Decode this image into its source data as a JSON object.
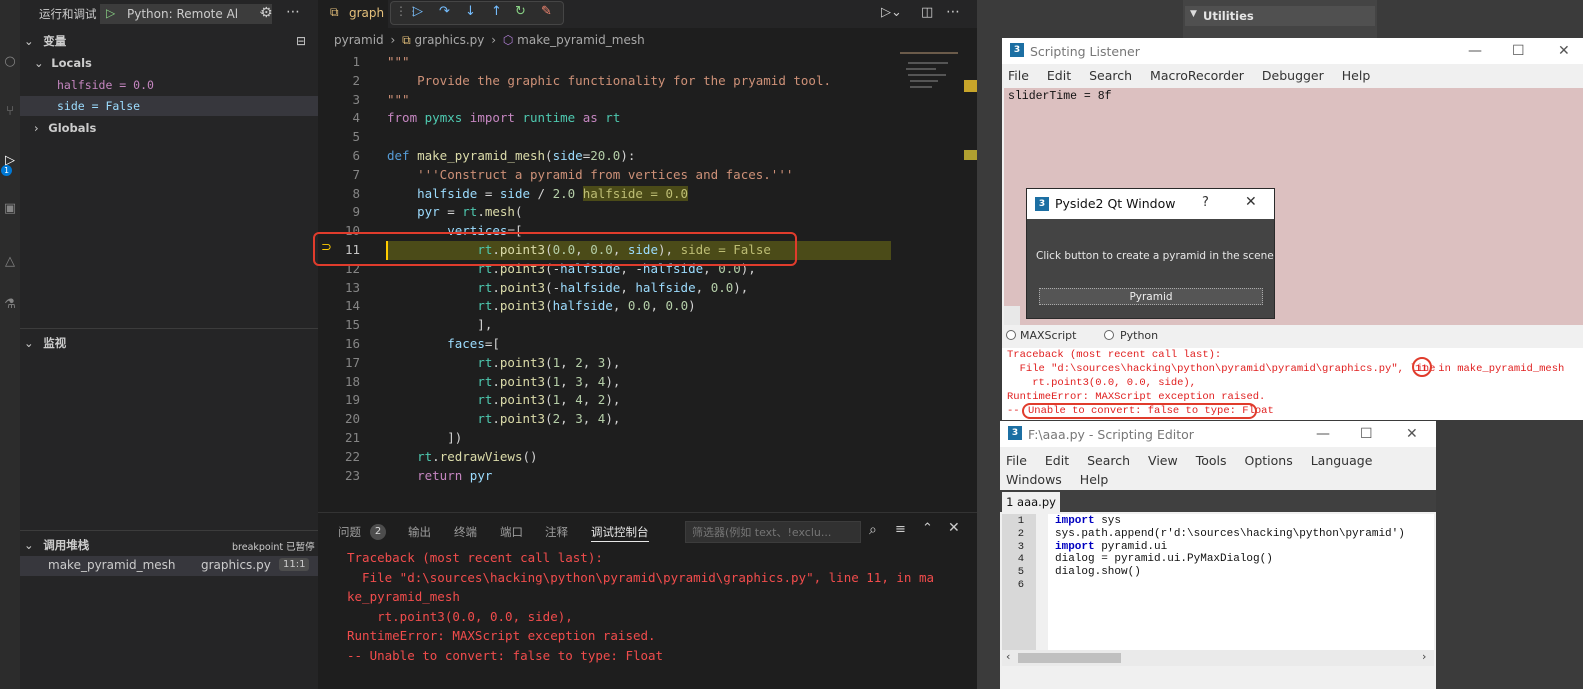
{
  "vscode": {
    "run_debug_title": "运行和调试",
    "launch_config": "Python: Remote Al",
    "editor_tab": "graph",
    "breadcrumb": [
      "pyramid",
      "graphics.py",
      "make_pyramid_mesh"
    ],
    "variables": {
      "header": "变量",
      "locals_label": "Locals",
      "locals": [
        "halfside = 0.0",
        "side = False"
      ],
      "globals_label": "Globals"
    },
    "watch_header": "监视",
    "callstack": {
      "header": "调用堆栈",
      "status": "breakpoint 已暂停",
      "frame_name": "make_pyramid_mesh",
      "frame_file": "graphics.py",
      "frame_pos": "11:1"
    },
    "activity_badge": "1",
    "code_lines": [
      {
        "n": "1",
        "segments": [
          {
            "t": "\"\"\"",
            "c": "str"
          }
        ]
      },
      {
        "n": "2",
        "segments": [
          {
            "t": "    Provide the graphic functionality for the pryamid tool.",
            "c": "str"
          }
        ]
      },
      {
        "n": "3",
        "segments": [
          {
            "t": "\"\"\"",
            "c": "str"
          }
        ]
      },
      {
        "n": "4",
        "segments": [
          {
            "t": "from ",
            "c": "kw"
          },
          {
            "t": "pymxs",
            "c": "cl"
          },
          {
            "t": " import ",
            "c": "kw"
          },
          {
            "t": "runtime",
            "c": "cl"
          },
          {
            "t": " as ",
            "c": "kw"
          },
          {
            "t": "rt",
            "c": "cl"
          }
        ]
      },
      {
        "n": "5",
        "segments": []
      },
      {
        "n": "6",
        "segments": [
          {
            "t": "def ",
            "c": "kb"
          },
          {
            "t": "make_pyramid_mesh",
            "c": "fn"
          },
          {
            "t": "(",
            "c": ""
          },
          {
            "t": "side",
            "c": "var"
          },
          {
            "t": "=",
            "c": ""
          },
          {
            "t": "20.0",
            "c": "num"
          },
          {
            "t": "):",
            "c": ""
          }
        ]
      },
      {
        "n": "7",
        "segments": [
          {
            "t": "    '''Construct a pyramid from vertices and faces.'''",
            "c": "str"
          }
        ]
      },
      {
        "n": "8",
        "segments": [
          {
            "t": "    ",
            "c": ""
          },
          {
            "t": "halfside",
            "c": "var"
          },
          {
            "t": " = ",
            "c": ""
          },
          {
            "t": "side",
            "c": "var"
          },
          {
            "t": " / ",
            "c": ""
          },
          {
            "t": "2.0",
            "c": "num"
          },
          {
            "t": " ",
            "c": ""
          },
          {
            "t": "halfside = 0.0",
            "c": "inl"
          }
        ]
      },
      {
        "n": "9",
        "segments": [
          {
            "t": "    ",
            "c": ""
          },
          {
            "t": "pyr",
            "c": "var"
          },
          {
            "t": " = ",
            "c": ""
          },
          {
            "t": "rt",
            "c": "cl"
          },
          {
            "t": ".",
            "c": ""
          },
          {
            "t": "mesh",
            "c": "fn"
          },
          {
            "t": "(",
            "c": ""
          }
        ]
      },
      {
        "n": "10",
        "segments": [
          {
            "t": "        ",
            "c": ""
          },
          {
            "t": "vertices",
            "c": "var"
          },
          {
            "t": "=[",
            "c": ""
          }
        ]
      },
      {
        "n": "11",
        "segments": [
          {
            "t": "            ",
            "c": ""
          },
          {
            "t": "rt",
            "c": "cl"
          },
          {
            "t": ".",
            "c": ""
          },
          {
            "t": "point3",
            "c": "fn"
          },
          {
            "t": "(",
            "c": ""
          },
          {
            "t": "0.0",
            "c": "num"
          },
          {
            "t": ", ",
            "c": ""
          },
          {
            "t": "0.0",
            "c": "num"
          },
          {
            "t": ", ",
            "c": ""
          },
          {
            "t": "side",
            "c": "var"
          },
          {
            "t": "), ",
            "c": ""
          },
          {
            "t": "side = False",
            "c": "inl"
          }
        ]
      },
      {
        "n": "12",
        "segments": [
          {
            "t": "            ",
            "c": ""
          },
          {
            "t": "rt",
            "c": "cl"
          },
          {
            "t": ".",
            "c": ""
          },
          {
            "t": "point3",
            "c": "fn"
          },
          {
            "t": "(-",
            "c": ""
          },
          {
            "t": "halfside",
            "c": "var"
          },
          {
            "t": ", -",
            "c": ""
          },
          {
            "t": "halfside",
            "c": "var"
          },
          {
            "t": ", ",
            "c": ""
          },
          {
            "t": "0.0",
            "c": "num"
          },
          {
            "t": "),",
            "c": ""
          }
        ]
      },
      {
        "n": "13",
        "segments": [
          {
            "t": "            ",
            "c": ""
          },
          {
            "t": "rt",
            "c": "cl"
          },
          {
            "t": ".",
            "c": ""
          },
          {
            "t": "point3",
            "c": "fn"
          },
          {
            "t": "(-",
            "c": ""
          },
          {
            "t": "halfside",
            "c": "var"
          },
          {
            "t": ", ",
            "c": ""
          },
          {
            "t": "halfside",
            "c": "var"
          },
          {
            "t": ", ",
            "c": ""
          },
          {
            "t": "0.0",
            "c": "num"
          },
          {
            "t": "),",
            "c": ""
          }
        ]
      },
      {
        "n": "14",
        "segments": [
          {
            "t": "            ",
            "c": ""
          },
          {
            "t": "rt",
            "c": "cl"
          },
          {
            "t": ".",
            "c": ""
          },
          {
            "t": "point3",
            "c": "fn"
          },
          {
            "t": "(",
            "c": ""
          },
          {
            "t": "halfside",
            "c": "var"
          },
          {
            "t": ", ",
            "c": ""
          },
          {
            "t": "0.0",
            "c": "num"
          },
          {
            "t": ", ",
            "c": ""
          },
          {
            "t": "0.0",
            "c": "num"
          },
          {
            "t": ")",
            "c": ""
          }
        ]
      },
      {
        "n": "15",
        "segments": [
          {
            "t": "            ],",
            "c": ""
          }
        ]
      },
      {
        "n": "16",
        "segments": [
          {
            "t": "        ",
            "c": ""
          },
          {
            "t": "faces",
            "c": "var"
          },
          {
            "t": "=[",
            "c": ""
          }
        ]
      },
      {
        "n": "17",
        "segments": [
          {
            "t": "            ",
            "c": ""
          },
          {
            "t": "rt",
            "c": "cl"
          },
          {
            "t": ".",
            "c": ""
          },
          {
            "t": "point3",
            "c": "fn"
          },
          {
            "t": "(",
            "c": ""
          },
          {
            "t": "1",
            "c": "num"
          },
          {
            "t": ", ",
            "c": ""
          },
          {
            "t": "2",
            "c": "num"
          },
          {
            "t": ", ",
            "c": ""
          },
          {
            "t": "3",
            "c": "num"
          },
          {
            "t": "),",
            "c": ""
          }
        ]
      },
      {
        "n": "18",
        "segments": [
          {
            "t": "            ",
            "c": ""
          },
          {
            "t": "rt",
            "c": "cl"
          },
          {
            "t": ".",
            "c": ""
          },
          {
            "t": "point3",
            "c": "fn"
          },
          {
            "t": "(",
            "c": ""
          },
          {
            "t": "1",
            "c": "num"
          },
          {
            "t": ", ",
            "c": ""
          },
          {
            "t": "3",
            "c": "num"
          },
          {
            "t": ", ",
            "c": ""
          },
          {
            "t": "4",
            "c": "num"
          },
          {
            "t": "),",
            "c": ""
          }
        ]
      },
      {
        "n": "19",
        "segments": [
          {
            "t": "            ",
            "c": ""
          },
          {
            "t": "rt",
            "c": "cl"
          },
          {
            "t": ".",
            "c": ""
          },
          {
            "t": "point3",
            "c": "fn"
          },
          {
            "t": "(",
            "c": ""
          },
          {
            "t": "1",
            "c": "num"
          },
          {
            "t": ", ",
            "c": ""
          },
          {
            "t": "4",
            "c": "num"
          },
          {
            "t": ", ",
            "c": ""
          },
          {
            "t": "2",
            "c": "num"
          },
          {
            "t": "),",
            "c": ""
          }
        ]
      },
      {
        "n": "20",
        "segments": [
          {
            "t": "            ",
            "c": ""
          },
          {
            "t": "rt",
            "c": "cl"
          },
          {
            "t": ".",
            "c": ""
          },
          {
            "t": "point3",
            "c": "fn"
          },
          {
            "t": "(",
            "c": ""
          },
          {
            "t": "2",
            "c": "num"
          },
          {
            "t": ", ",
            "c": ""
          },
          {
            "t": "3",
            "c": "num"
          },
          {
            "t": ", ",
            "c": ""
          },
          {
            "t": "4",
            "c": "num"
          },
          {
            "t": "),",
            "c": ""
          }
        ]
      },
      {
        "n": "21",
        "segments": [
          {
            "t": "        ])",
            "c": ""
          }
        ]
      },
      {
        "n": "22",
        "segments": [
          {
            "t": "    ",
            "c": ""
          },
          {
            "t": "rt",
            "c": "cl"
          },
          {
            "t": ".",
            "c": ""
          },
          {
            "t": "redrawViews",
            "c": "fn"
          },
          {
            "t": "()",
            "c": ""
          }
        ]
      },
      {
        "n": "23",
        "segments": [
          {
            "t": "    ",
            "c": ""
          },
          {
            "t": "return ",
            "c": "kw"
          },
          {
            "t": "pyr",
            "c": "var"
          }
        ]
      }
    ],
    "panel": {
      "tabs": [
        "问题",
        "输出",
        "终端",
        "端口",
        "注释",
        "调试控制台"
      ],
      "problems_count": "2",
      "filter_placeholder": "筛选器(例如 text、!exclu...",
      "console_lines": [
        "Traceback (most recent call last):",
        "  File \"d:\\sources\\hacking\\python\\pyramid\\pyramid\\graphics.py\", line 11, in ma",
        "ke_pyramid_mesh",
        "    rt.point3(0.0, 0.0, side),",
        "RuntimeError: MAXScript exception raised.",
        "-- Unable to convert: false to type: Float"
      ]
    }
  },
  "max": {
    "utilities_label": "Utilities",
    "listener": {
      "title": "Scripting Listener",
      "menu": [
        "File",
        "Edit",
        "Search",
        "MacroRecorder",
        "Debugger",
        "Help"
      ],
      "content": "sliderTime = 8f",
      "radio_maxscript": "MAXScript",
      "radio_python": "Python",
      "error_lines": [
        "Traceback (most recent call last):",
        "  File \"d:\\sources\\hacking\\python\\pyramid\\pyramid\\graphics.py\", line",
        "11",
        " in make_pyramid_mesh",
        "    rt.point3(0.0, 0.0, side),",
        "RuntimeError: MAXScript exception raised.",
        "-- ",
        "Unable to convert: false to type: Float"
      ]
    },
    "qt_window": {
      "title": "Pyside2 Qt Window",
      "help": "?",
      "text": "Click button to create a pyramid in the scene",
      "button": "Pyramid"
    },
    "editor": {
      "title": "F:\\aaa.py - Scripting Editor",
      "menu": [
        "File",
        "Edit",
        "Search",
        "View",
        "Tools",
        "Options",
        "Language",
        "Windows",
        "Help"
      ],
      "tab": "1 aaa.py",
      "lines": [
        {
          "n": "1",
          "text": "import sys"
        },
        {
          "n": "2",
          "text": "sys.path.append(r'd:\\sources\\hacking\\python\\pyramid')"
        },
        {
          "n": "3",
          "text": "import pyramid.ui"
        },
        {
          "n": "4",
          "text": "dialog = pyramid.ui.PyMaxDialog()"
        },
        {
          "n": "5",
          "text": "dialog.show()"
        },
        {
          "n": "6",
          "text": ""
        }
      ]
    }
  }
}
